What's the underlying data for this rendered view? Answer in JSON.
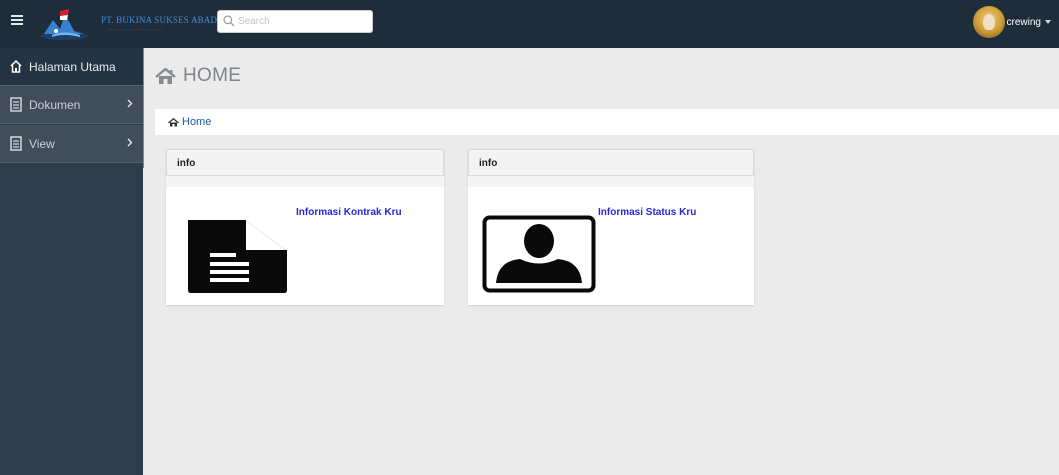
{
  "header": {
    "brand": "PT. BUKINA SUKSES ABADI",
    "search_placeholder": "Search",
    "user_name": "crewing",
    "icons": [
      "menu-icon",
      "company-logo",
      "search-icon",
      "avatar",
      "caret-down-icon"
    ]
  },
  "sidebar": {
    "items": [
      {
        "label": "Halaman Utama",
        "icon": "home-icon"
      },
      {
        "label": "Dokumen",
        "icon": "document-icon"
      },
      {
        "label": "View",
        "icon": "document-icon"
      }
    ]
  },
  "page": {
    "title": "HOME",
    "breadcrumb": "Home"
  },
  "cards": [
    {
      "header": "info",
      "link": "Informasi Kontrak Kru",
      "icon": "document-file-icon"
    },
    {
      "header": "info",
      "link": "Informasi Status Kru",
      "icon": "user-profile-icon"
    }
  ],
  "colors": {
    "topbar": "#1f2d3b",
    "sidebar": "#2f3d4a",
    "link": "#2727d6",
    "breadcrumb_link": "#1a57a8"
  }
}
